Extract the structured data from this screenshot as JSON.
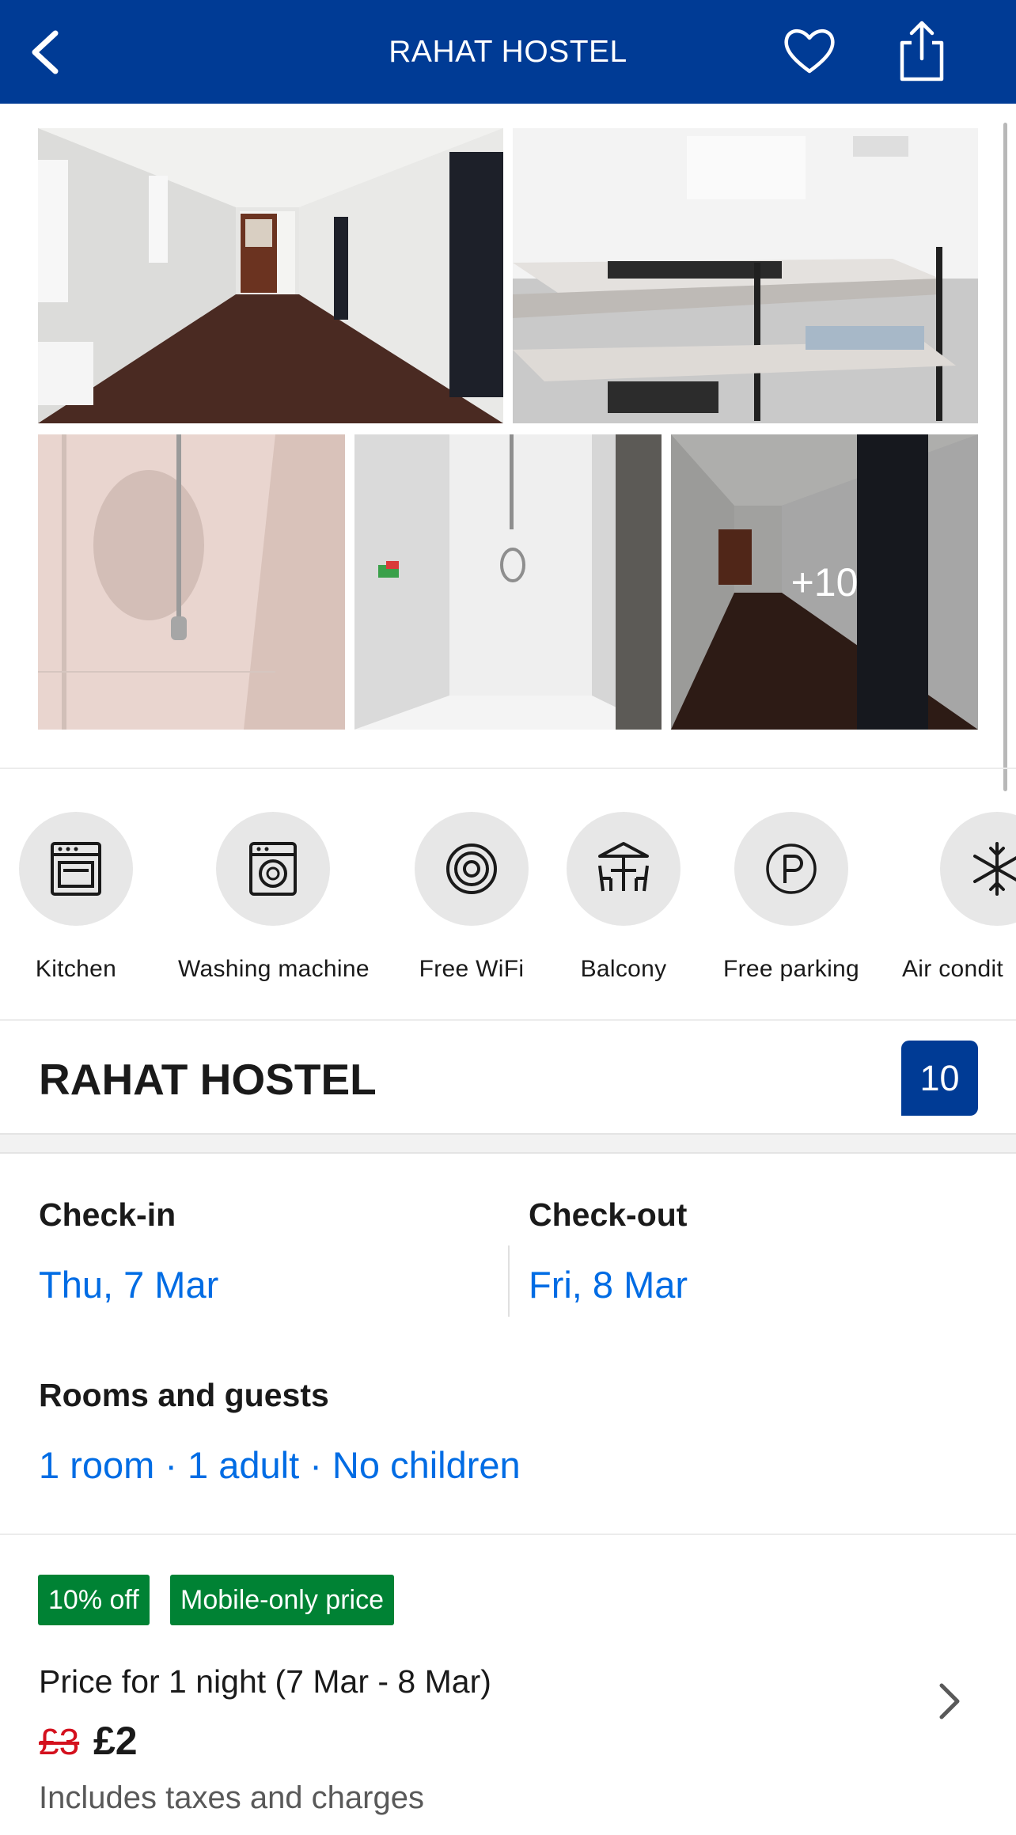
{
  "header": {
    "title": "RAHAT HOSTEL",
    "icons": [
      "back-chevron-icon",
      "heart-icon",
      "share-icon"
    ],
    "background": "#003b95"
  },
  "gallery": {
    "more_photos_label": "+10",
    "photo_subjects": [
      "hallway",
      "bunk-beds",
      "shower",
      "shower-tiles",
      "hallway-curtain"
    ]
  },
  "facilities": [
    {
      "label": "Kitchen",
      "icon": "oven-icon"
    },
    {
      "label": "Washing machine",
      "icon": "washing-machine-icon"
    },
    {
      "label": "Free WiFi",
      "icon": "wifi-at-icon"
    },
    {
      "label": "Balcony",
      "icon": "balcony-table-icon"
    },
    {
      "label": "Free parking",
      "icon": "parking-icon"
    },
    {
      "label": "Air condit",
      "icon": "snowflake-icon"
    }
  ],
  "property": {
    "name": "RAHAT HOSTEL",
    "score": "10"
  },
  "stay": {
    "checkin_label": "Check-in",
    "checkin_value": "Thu, 7 Mar",
    "checkout_label": "Check-out",
    "checkout_value": "Fri, 8 Mar",
    "guests_label": "Rooms and guests",
    "guests_value": "1 room · 1 adult · No children"
  },
  "price": {
    "badges": [
      "10% off",
      "Mobile-only price"
    ],
    "description": "Price for 1 night (7 Mar - 8 Mar)",
    "old_price": "£3",
    "new_price": "£2",
    "taxes_note": "Includes taxes and charges"
  },
  "colors": {
    "brand_blue": "#003b95",
    "link_blue": "#006ce4",
    "deal_green": "#008234",
    "strike_red": "#d4111e"
  }
}
